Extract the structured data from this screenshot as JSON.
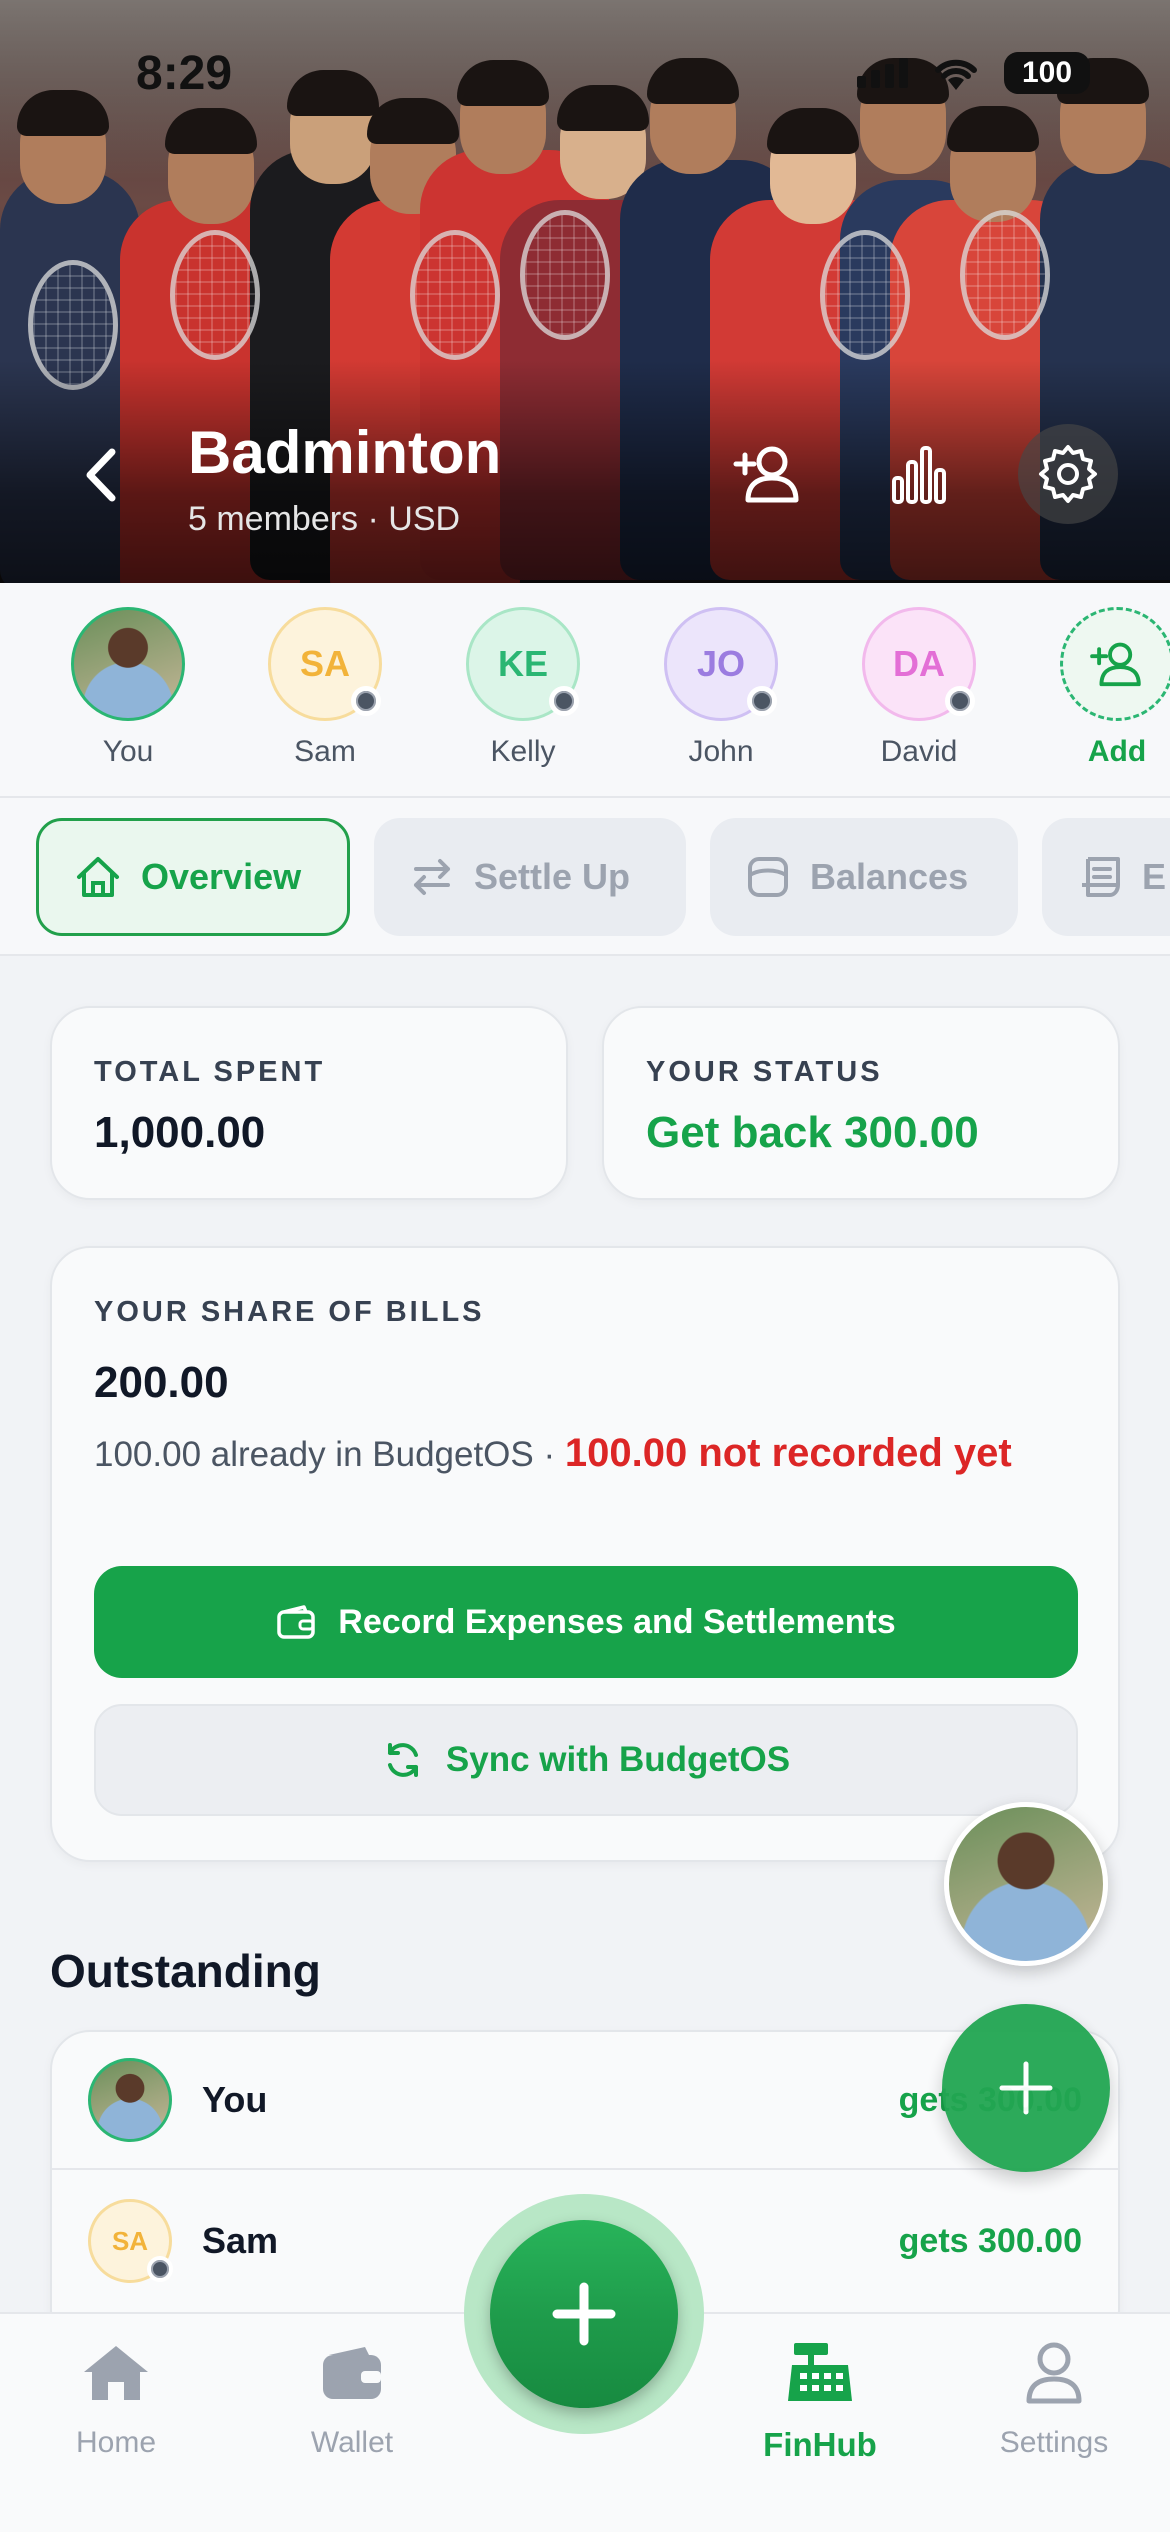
{
  "status_bar": {
    "time": "8:29",
    "battery": "100"
  },
  "header": {
    "title": "Badminton",
    "subtitle": "5 members · USD"
  },
  "members": [
    {
      "label": "You",
      "initials": "",
      "photo": true
    },
    {
      "label": "Sam",
      "initials": "SA",
      "color": "#f2b33a",
      "bg": "#fdf3dc",
      "border": "#f7dc9c"
    },
    {
      "label": "Kelly",
      "initials": "KE",
      "color": "#2bb673",
      "bg": "#dcf5e8",
      "border": "#a9e6c6"
    },
    {
      "label": "John",
      "initials": "JO",
      "color": "#9b7ce0",
      "bg": "#ece5fb",
      "border": "#cfc0f3"
    },
    {
      "label": "David",
      "initials": "DA",
      "color": "#e36fd6",
      "bg": "#fbe3f8",
      "border": "#f2b9ec"
    }
  ],
  "add_member_label": "Add",
  "tabs": [
    {
      "label": "Overview",
      "icon": "home-icon",
      "active": true
    },
    {
      "label": "Settle Up",
      "icon": "arrows-swap-icon",
      "active": false
    },
    {
      "label": "Balances",
      "icon": "wallet-icon",
      "active": false
    },
    {
      "label": "E",
      "icon": "receipt-icon",
      "active": false
    }
  ],
  "summary": {
    "total_spent_label": "TOTAL SPENT",
    "total_spent_value": "1,000.00",
    "status_label": "YOUR STATUS",
    "status_value": "Get back 300.00"
  },
  "share": {
    "label": "YOUR SHARE OF BILLS",
    "value": "200.00",
    "recorded_text": "100.00 already in BudgetOS · ",
    "not_recorded_text": "100.00 not recorded yet",
    "record_button": "Record Expenses and Settlements",
    "sync_button": "Sync with BudgetOS"
  },
  "outstanding": {
    "title": "Outstanding",
    "rows": [
      {
        "name": "You",
        "amount": "gets 300.00"
      },
      {
        "name": "Sam",
        "initials": "SA",
        "amount": "gets 300.00"
      }
    ]
  },
  "bottom_nav": [
    {
      "label": "Home",
      "icon": "home-icon"
    },
    {
      "label": "Wallet",
      "icon": "wallet-icon"
    },
    {
      "label": "FinHub",
      "icon": "cash-register-icon",
      "active": true
    },
    {
      "label": "Settings",
      "icon": "person-icon"
    }
  ],
  "colors": {
    "accent": "#16a34a",
    "danger": "#dc2626"
  }
}
